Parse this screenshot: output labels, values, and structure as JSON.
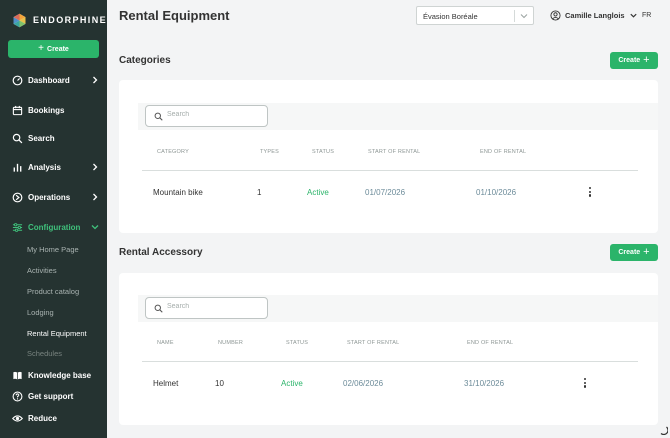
{
  "app": {
    "brand": "ENDORPHINE"
  },
  "sidebar": {
    "create_label": "Create",
    "items": [
      {
        "label": "Dashboard",
        "icon": "dashboard-icon"
      },
      {
        "label": "Bookings",
        "icon": "calendar-icon"
      },
      {
        "label": "Search",
        "icon": "search-icon"
      },
      {
        "label": "Analysis",
        "icon": "bar-chart-icon"
      },
      {
        "label": "Operations",
        "icon": "operations-icon"
      },
      {
        "label": "Configuration",
        "icon": "sliders-icon"
      }
    ],
    "sub_items": [
      "My Home Page",
      "Activities",
      "Product catalog",
      "Lodging",
      "Rental Equipment",
      "Schedules"
    ],
    "bottom_items": [
      {
        "label": "Knowledge base",
        "icon": "book-icon"
      },
      {
        "label": "Get support",
        "icon": "help-icon"
      },
      {
        "label": "Reduce",
        "icon": "eye-icon"
      }
    ]
  },
  "header": {
    "title": "Rental Equipment",
    "company": "Évasion Boréale",
    "user": "Camille Langlois",
    "language": "FR"
  },
  "categories": {
    "title": "Categories",
    "create_label": "Create",
    "search_placeholder": "Search",
    "columns": [
      "CATEGORY",
      "TYPES",
      "STATUS",
      "START OF RENTAL",
      "END OF RENTAL"
    ],
    "rows": [
      {
        "category": "Mountain bike",
        "types": "1",
        "status": "Active",
        "start": "01/07/2026",
        "end": "01/10/2026"
      }
    ]
  },
  "accessories": {
    "title": "Rental Accessory",
    "create_label": "Create",
    "search_placeholder": "Search",
    "columns": [
      "NAME",
      "NUMBER",
      "STATUS",
      "START OF RENTAL",
      "END OF RENTAL"
    ],
    "rows": [
      {
        "name": "Helmet",
        "number": "10",
        "status": "Active",
        "start": "02/06/2026",
        "end": "31/10/2026"
      }
    ]
  },
  "colors": {
    "sidebar": "#253331",
    "accent": "#2bb46a",
    "status_active": "#2bb46a",
    "date": "#6c8b99"
  }
}
